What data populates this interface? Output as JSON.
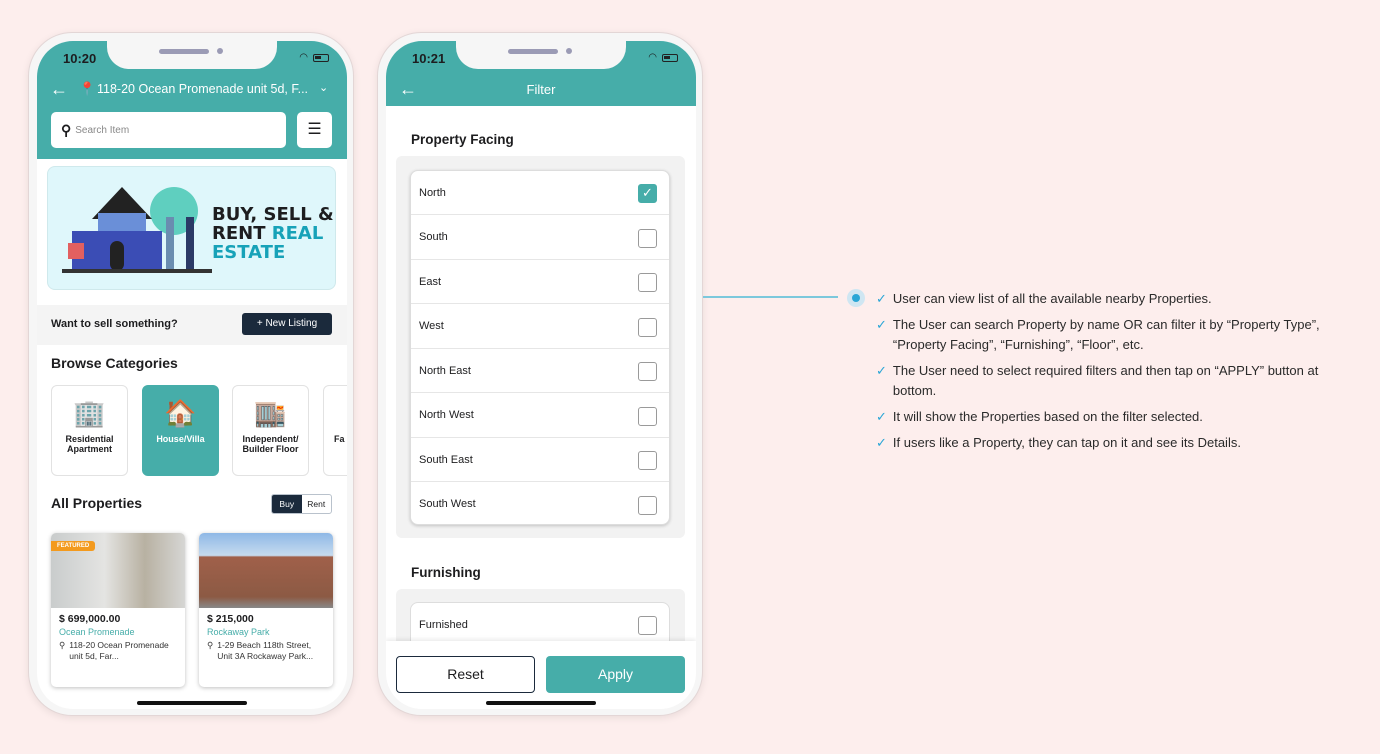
{
  "colors": {
    "accent": "#46ada9",
    "dark": "#1b2a3c",
    "background": "#fdeeed"
  },
  "home": {
    "time": "10:20",
    "location": "118-20 Ocean Promenade unit 5d, F...",
    "search_placeholder": "Search Item",
    "banner": {
      "line1": "BUY, SELL &",
      "line2a": "RENT ",
      "line2b": "REAL",
      "line3": "ESTATE"
    },
    "sell_prompt": "Want to sell something?",
    "new_listing": "+ New Listing",
    "browse_title": "Browse Categories",
    "categories": [
      {
        "label": "Residential Apartment"
      },
      {
        "label": "House/Villa",
        "selected": true
      },
      {
        "label": "Independent/ Builder Floor"
      },
      {
        "label": "Fa"
      }
    ],
    "all_props_title": "All Properties",
    "toggle": {
      "buy": "Buy",
      "rent": "Rent",
      "selected": "Buy"
    },
    "properties": [
      {
        "badge": "FEATURED",
        "price": "$ 699,000.00",
        "name": "Ocean Promenade",
        "address": "118-20 Ocean Promenade unit 5d, Far..."
      },
      {
        "price": "$ 215,000",
        "name": "Rockaway Park",
        "address": "1-29 Beach 118th Street, Unit 3A Rockaway Park..."
      }
    ]
  },
  "filter": {
    "time": "10:21",
    "title": "Filter",
    "facing_title": "Property Facing",
    "facing_options": [
      {
        "label": "North",
        "checked": true
      },
      {
        "label": "South",
        "checked": false
      },
      {
        "label": "East",
        "checked": false
      },
      {
        "label": "West",
        "checked": false
      },
      {
        "label": "North East",
        "checked": false
      },
      {
        "label": "North West",
        "checked": false
      },
      {
        "label": "South East",
        "checked": false
      },
      {
        "label": "South West",
        "checked": false
      }
    ],
    "furnishing_title": "Furnishing",
    "furnishing_options": [
      {
        "label": "Furnished",
        "checked": false
      }
    ],
    "reset": "Reset",
    "apply": "Apply"
  },
  "features": [
    "User can view list of all the available nearby Properties.",
    "The User can search Property by name OR can filter it by “Property Type”, “Property Facing”, “Furnishing”, “Floor”, etc.",
    "The User need to select required filters and then tap on “APPLY” button at bottom.",
    "It will show the Properties based on the filter selected.",
    "If users like a Property, they can tap on it and see its Details."
  ]
}
